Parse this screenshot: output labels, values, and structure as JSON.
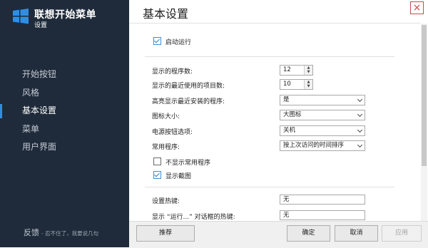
{
  "sidebar": {
    "app_title": "联想开始菜单",
    "app_subtitle": "设置",
    "logo_icon": "windows-logo-icon",
    "items": [
      {
        "label": "开始按钮"
      },
      {
        "label": "风格"
      },
      {
        "label": "基本设置",
        "active": true
      },
      {
        "label": "菜单"
      },
      {
        "label": "用户界面"
      }
    ],
    "feedback_label": "反馈",
    "feedback_note": "- 忍不住了，我要说几句"
  },
  "header": {
    "title": "基本设置",
    "close_glyph": "×"
  },
  "settings": {
    "autostart_label": "启动运行",
    "program_count_label": "显示的程序数:",
    "program_count_value": "12",
    "recent_items_label": "显示的最近使用的项目数:",
    "recent_items_value": "10",
    "highlight_label": "高亮显示最近安装的程序:",
    "highlight_value": "是",
    "icon_size_label": "图标大小:",
    "icon_size_value": "大图标",
    "power_button_label": "电源按钮选项:",
    "power_button_value": "关机",
    "common_programs_label": "常用程序:",
    "common_programs_value": "按上次访问的时间排序",
    "hide_common_label": "不显示常用程序",
    "show_screenshot_label": "显示截图",
    "hotkey_label": "设置热键:",
    "hotkey_value": "无",
    "run_hotkey_label": "显示 “运行...” 对话框的热键:",
    "run_hotkey_value": "无",
    "autostart_checked": true,
    "hide_common_checked": false,
    "show_screenshot_checked": true
  },
  "footer": {
    "recommend_label": "推荐",
    "ok_label": "确定",
    "cancel_label": "取消",
    "apply_label": "应用"
  },
  "colors": {
    "sidebar_bg": "#1f2b3a",
    "accent": "#2f8ee4",
    "close": "#c84a4a"
  }
}
